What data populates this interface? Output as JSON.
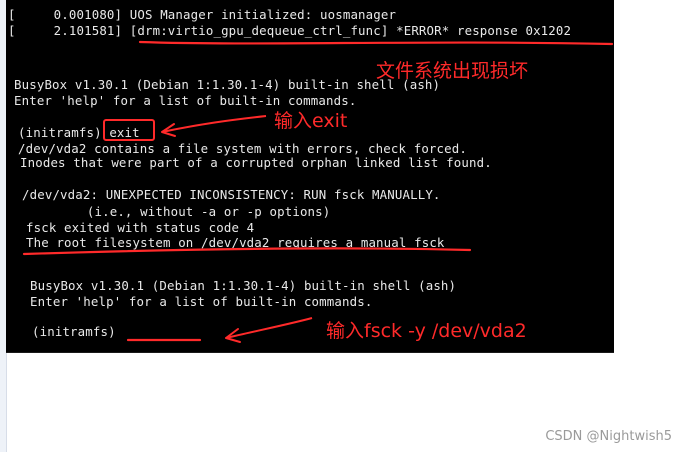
{
  "terminal": {
    "lines": [
      "[     0.001080] UOS Manager initialized: uosmanager",
      "[     2.101581] [drm:virtio_gpu_dequeue_ctrl_func] *ERROR* response 0x1202",
      "BusyBox v1.30.1 (Debian 1:1.30.1-4) built-in shell (ash)",
      "Enter 'help' for a list of built-in commands.",
      "(initramfs) exit",
      "/dev/vda2 contains a file system with errors, check forced.",
      "Inodes that were part of a corrupted orphan linked list found.",
      "/dev/vda2: UNEXPECTED INCONSISTENCY: RUN fsck MANUALLY.",
      "        (i.e., without -a or -p options)",
      "fsck exited with status code 4",
      "The root filesystem on /dev/vda2 requires a manual fsck",
      "BusyBox v1.30.1 (Debian 1:1.30.1-4) built-in shell (ash)",
      "Enter 'help' for a list of built-in commands.",
      "(initramfs)"
    ]
  },
  "annotations": {
    "fs_damaged": "文件系统出现损坏",
    "input_exit": "输入exit",
    "input_fsck": "输入fsck -y /dev/vda2",
    "color": "#ff2a2a"
  },
  "watermark": "CSDN @Nightwish5"
}
